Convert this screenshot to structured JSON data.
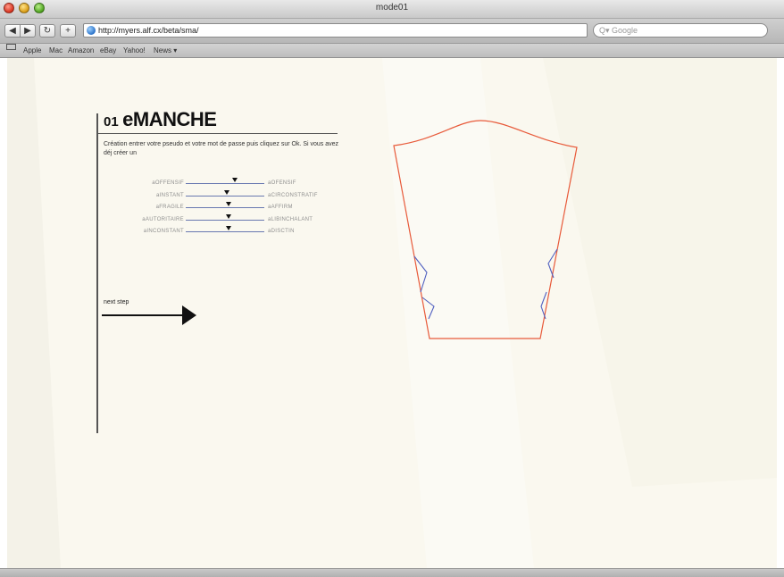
{
  "window": {
    "title": "mode01"
  },
  "toolbar": {
    "back_glyph": "◀",
    "forward_glyph": "▶",
    "reload_glyph": "↻",
    "add_glyph": "+",
    "url": "http://myers.alf.cx/beta/sma/",
    "search_placeholder": "Q▾ Google"
  },
  "bookmarks": {
    "items": [
      {
        "label": "Apple"
      },
      {
        "label": "Mac"
      },
      {
        "label": "Amazon"
      },
      {
        "label": "eBay"
      },
      {
        "label": "Yahoo!"
      },
      {
        "label": "News ▾"
      }
    ]
  },
  "section": {
    "number": "01",
    "name": "eMANCHE",
    "description": "Création entrer votre pseudo et votre mot de passe puis cliquez sur Ok. Si vous avez déj créer un"
  },
  "sliders": [
    {
      "left": "aOFFENSIF",
      "right": "aOFENSIF",
      "value": 0.62
    },
    {
      "left": "aINSTANT",
      "right": "aCIRCONSTRATIF",
      "value": 0.52
    },
    {
      "left": "aFRAGILE",
      "right": "aAFFIRM",
      "value": 0.55
    },
    {
      "left": "aAUTORITAIRE",
      "right": "aLIBINCHALANT",
      "value": 0.55
    },
    {
      "left": "aINCONSTANT",
      "right": "aDISCTIN",
      "value": 0.55
    }
  ],
  "next": {
    "label": "next step"
  },
  "colors": {
    "pattern_outline": "#e85a3a",
    "dart": "#5060c0",
    "page_background": "#faf8ef",
    "slider_track": "#6878b0"
  },
  "icons": {
    "address_icon": "globe-icon",
    "next_icon": "arrow-right-icon",
    "bookmarks_icon": "open-book-icon"
  }
}
